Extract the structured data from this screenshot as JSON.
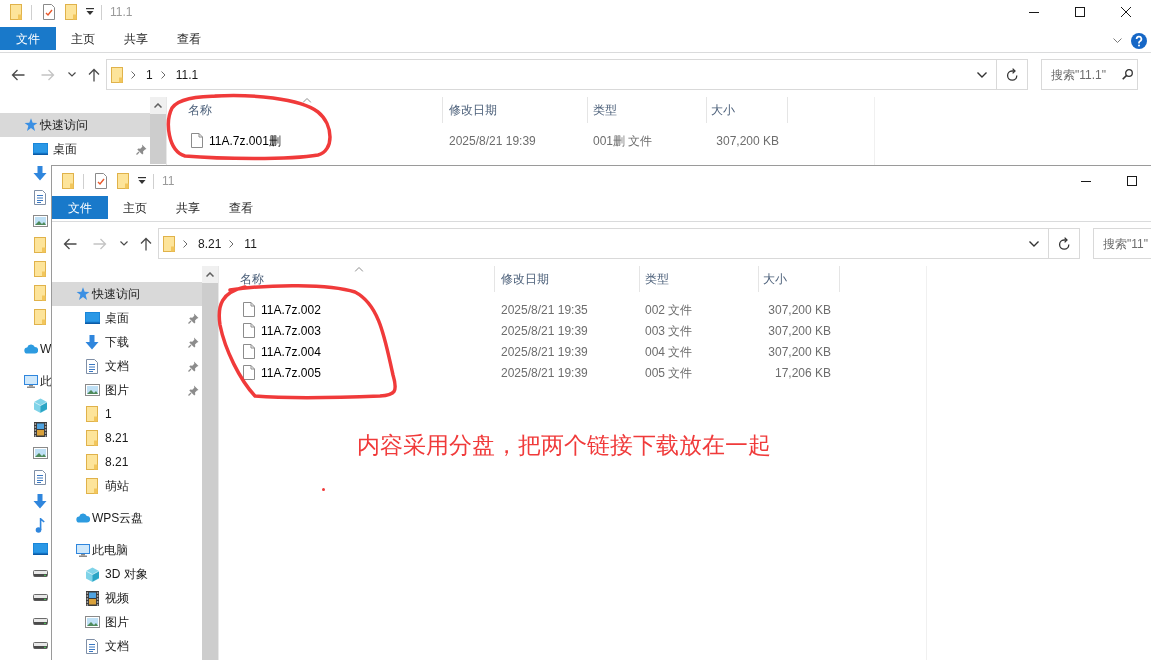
{
  "windows": [
    {
      "title": "11.1",
      "window_controls": [
        {
          "kind": "minimize"
        },
        {
          "kind": "maximize"
        },
        {
          "kind": "close"
        }
      ],
      "ribbon_tabs": [
        {
          "label": "文件",
          "kind": "file"
        },
        {
          "label": "主页",
          "kind": "tab"
        },
        {
          "label": "共享",
          "kind": "tab"
        },
        {
          "label": "查看",
          "kind": "tab"
        }
      ],
      "ribbon_extras": [
        {
          "kind": "expand"
        },
        {
          "kind": "help"
        }
      ],
      "nav_buttons": [
        {
          "kind": "back",
          "disabled": false
        },
        {
          "kind": "forward",
          "disabled": true
        },
        {
          "kind": "recent",
          "disabled": false
        },
        {
          "kind": "up",
          "disabled": false
        }
      ],
      "address_bar": {
        "crumbs": [
          "1",
          "11.1"
        ]
      },
      "search": {
        "placeholder": "搜索\"11.1\"",
        "button": true
      },
      "navigation_pane": [
        {
          "label": "快速访问",
          "kind": "quick-access",
          "selected": true,
          "children": [
            {
              "label": "桌面",
              "kind": "desktop",
              "selected": false,
              "pinned": true
            },
            {
              "kind": "download",
              "selected": false
            },
            {
              "kind": "document",
              "selected": false
            },
            {
              "kind": "picture",
              "selected": false
            },
            {
              "kind": "folder",
              "selected": false
            },
            {
              "kind": "folder",
              "selected": false
            },
            {
              "kind": "folder",
              "selected": false
            },
            {
              "kind": "folder",
              "selected": false
            }
          ]
        },
        {
          "label": "W",
          "kind": "cloud",
          "selected": false
        },
        {
          "label": "此",
          "kind": "computer",
          "selected": false,
          "children": [
            {
              "kind": "cube",
              "selected": false
            },
            {
              "kind": "video",
              "selected": false
            },
            {
              "kind": "picture",
              "selected": false
            },
            {
              "kind": "document",
              "selected": false
            },
            {
              "kind": "download",
              "selected": false
            },
            {
              "kind": "music",
              "selected": false
            },
            {
              "kind": "desktop",
              "selected": false
            },
            {
              "kind": "drive",
              "selected": false
            },
            {
              "kind": "drive",
              "selected": false
            },
            {
              "kind": "drive",
              "selected": false
            },
            {
              "kind": "drive",
              "selected": false
            }
          ]
        }
      ],
      "columns": [
        {
          "label": "名称",
          "sorted": true
        },
        {
          "label": "修改日期",
          "sorted": false
        },
        {
          "label": "类型",
          "sorted": false
        },
        {
          "label": "大小",
          "sorted": false
        }
      ],
      "files": [
        {
          "name": "11A.7z.001删",
          "modified": "2025/8/21 19:39",
          "type": "001删 文件",
          "size": "307,200 KB"
        }
      ]
    },
    {
      "title": "11",
      "window_controls": [
        {
          "kind": "minimize"
        },
        {
          "kind": "maximize"
        }
      ],
      "ribbon_tabs": [
        {
          "label": "文件",
          "kind": "file"
        },
        {
          "label": "主页",
          "kind": "tab"
        },
        {
          "label": "共享",
          "kind": "tab"
        },
        {
          "label": "查看",
          "kind": "tab"
        }
      ],
      "nav_buttons": [
        {
          "kind": "back",
          "disabled": false
        },
        {
          "kind": "forward",
          "disabled": true
        },
        {
          "kind": "recent",
          "disabled": false
        },
        {
          "kind": "up",
          "disabled": false
        }
      ],
      "address_bar": {
        "crumbs": [
          "8.21",
          "11"
        ]
      },
      "search": {
        "placeholder": "搜索\"11\""
      },
      "navigation_pane": [
        {
          "label": "快速访问",
          "kind": "quick-access",
          "selected": true,
          "children": [
            {
              "label": "桌面",
              "kind": "desktop",
              "selected": false,
              "pinned": true
            },
            {
              "label": "下载",
              "kind": "download",
              "selected": false,
              "pinned": true
            },
            {
              "label": "文档",
              "kind": "document",
              "selected": false,
              "pinned": true
            },
            {
              "label": "图片",
              "kind": "picture",
              "selected": false,
              "pinned": true
            },
            {
              "label": "1",
              "kind": "folder",
              "selected": false,
              "pinned": false
            },
            {
              "label": "8.21",
              "kind": "folder",
              "selected": false,
              "pinned": false
            },
            {
              "label": "8.21",
              "kind": "folder",
              "selected": false,
              "pinned": false
            },
            {
              "label": "萌站",
              "kind": "folder",
              "selected": false,
              "pinned": false
            }
          ]
        },
        {
          "label": "WPS云盘",
          "kind": "cloud",
          "selected": false
        },
        {
          "label": "此电脑",
          "kind": "computer",
          "selected": false,
          "children": [
            {
              "label": "3D 对象",
              "kind": "cube",
              "selected": false
            },
            {
              "label": "视频",
              "kind": "video",
              "selected": false
            },
            {
              "label": "图片",
              "kind": "picture",
              "selected": false
            },
            {
              "label": "文档",
              "kind": "document",
              "selected": false
            }
          ]
        }
      ],
      "columns": [
        {
          "label": "名称",
          "sorted": true
        },
        {
          "label": "修改日期",
          "sorted": false
        },
        {
          "label": "类型",
          "sorted": false
        },
        {
          "label": "大小",
          "sorted": false
        }
      ],
      "files": [
        {
          "name": "11A.7z.002",
          "modified": "2025/8/21 19:35",
          "type": "002 文件",
          "size": "307,200 KB"
        },
        {
          "name": "11A.7z.003",
          "modified": "2025/8/21 19:39",
          "type": "003 文件",
          "size": "307,200 KB"
        },
        {
          "name": "11A.7z.004",
          "modified": "2025/8/21 19:39",
          "type": "004 文件",
          "size": "307,200 KB"
        },
        {
          "name": "11A.7z.005",
          "modified": "2025/8/21 19:39",
          "type": "005 文件",
          "size": "17,206 KB"
        }
      ]
    }
  ],
  "annotation": {
    "text": "内容采用分盘，把两个链接下载放在一起"
  }
}
